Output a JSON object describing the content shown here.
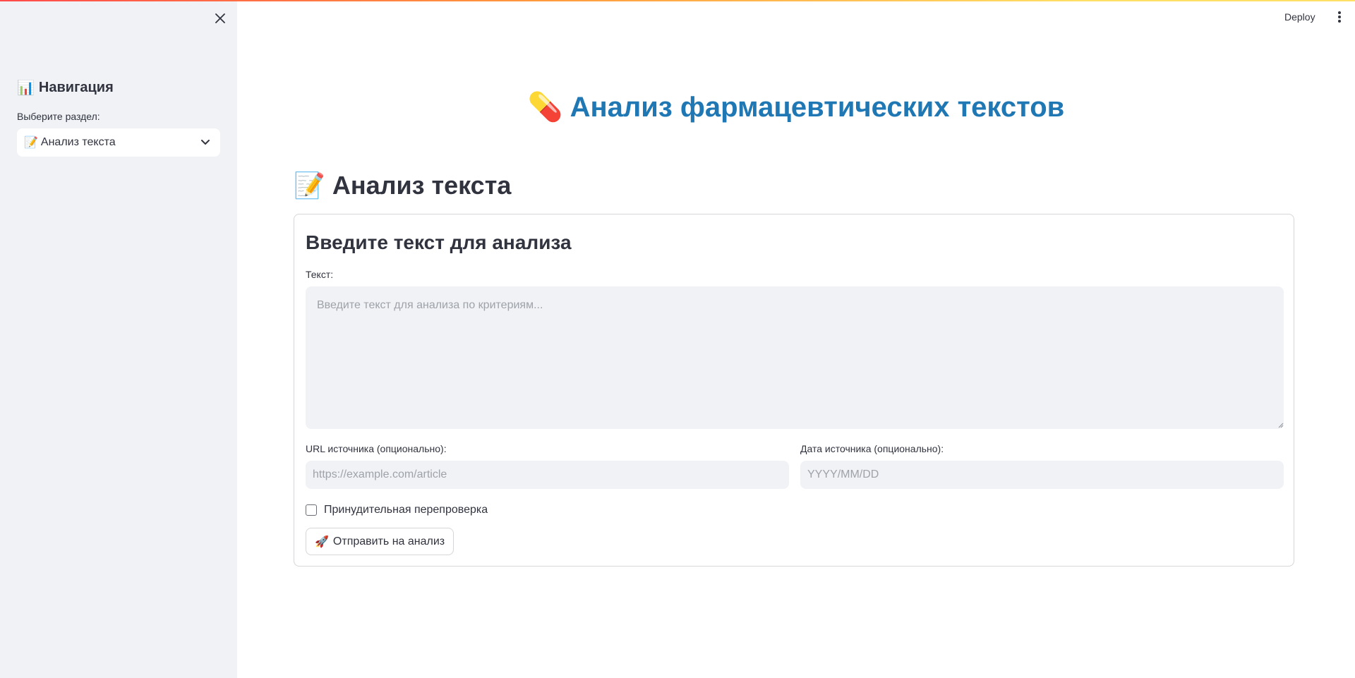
{
  "sidebar": {
    "heading_icon": "📊",
    "heading": "Навигация",
    "select_label": "Выберите раздел:",
    "select_icon": "📝",
    "select_value": "Анализ текста"
  },
  "header": {
    "deploy_label": "Deploy"
  },
  "main": {
    "title_icon": "💊",
    "title": "Анализ фармацевтических текстов",
    "section_icon": "📝",
    "section_title": "Анализ текста",
    "form": {
      "title": "Введите текст для анализа",
      "text_label": "Текст:",
      "text_placeholder": "Введите текст для анализа по критериям...",
      "text_value": "",
      "url_label": "URL источника (опционально):",
      "url_placeholder": "https://example.com/article",
      "url_value": "",
      "date_label": "Дата источника (опционально):",
      "date_placeholder": "YYYY/MM/DD",
      "date_value": "",
      "checkbox_label": "Принудительная перепроверка",
      "checkbox_checked": false,
      "submit_icon": "🚀",
      "submit_label": "Отправить на анализ"
    }
  },
  "colors": {
    "title_blue": "#1f77b4",
    "sidebar_bg": "#f0f2f6",
    "input_bg": "#f0f2f6",
    "text": "#31333f",
    "border": "#d6d6d9"
  },
  "icons": [
    "close-icon",
    "chevron-down-icon",
    "more-vertical-icon",
    "bar-chart-emoji",
    "memo-emoji",
    "pill-emoji",
    "rocket-emoji"
  ]
}
